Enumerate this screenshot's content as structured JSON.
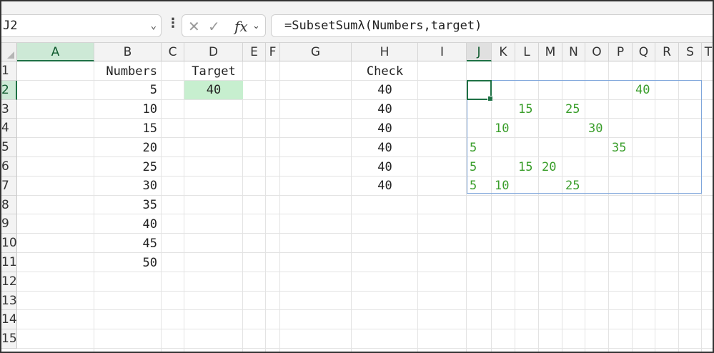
{
  "formula_bar": {
    "name_box": "J2",
    "formula": "=SubsetSumλ(Numbers,target)"
  },
  "icons": {
    "cancel": "close-icon",
    "confirm": "check-icon",
    "function": "fx-icon",
    "dropdown": "chevron-down-icon",
    "more": "kebab-icon"
  },
  "columns": [
    "A",
    "B",
    "C",
    "D",
    "E",
    "F",
    "G",
    "H",
    "I",
    "J",
    "K",
    "L",
    "M",
    "N",
    "O",
    "P",
    "Q",
    "R",
    "S",
    "T"
  ],
  "rows": [
    "1",
    "2",
    "3",
    "4",
    "5",
    "6",
    "7",
    "8",
    "9",
    "10",
    "11",
    "12",
    "13",
    "14",
    "15"
  ],
  "cells": {
    "B1": "Numbers",
    "B": [
      "5",
      "10",
      "15",
      "20",
      "25",
      "30",
      "35",
      "40",
      "45",
      "50"
    ],
    "D1": "Target",
    "D2": "40",
    "H1": "Check",
    "H": [
      "40",
      "40",
      "40",
      "40",
      "40",
      "40"
    ],
    "spill": [
      {
        "col": "Q",
        "row": 2,
        "value": "40"
      },
      {
        "col": "L",
        "row": 3,
        "value": "15"
      },
      {
        "col": "N",
        "row": 3,
        "value": "25"
      },
      {
        "col": "K",
        "row": 4,
        "value": "10"
      },
      {
        "col": "O",
        "row": 4,
        "value": "30"
      },
      {
        "col": "J",
        "row": 5,
        "value": "5"
      },
      {
        "col": "P",
        "row": 5,
        "value": "35"
      },
      {
        "col": "J",
        "row": 6,
        "value": "5"
      },
      {
        "col": "L",
        "row": 6,
        "value": "15"
      },
      {
        "col": "M",
        "row": 6,
        "value": "20"
      },
      {
        "col": "J",
        "row": 7,
        "value": "5"
      },
      {
        "col": "K",
        "row": 7,
        "value": "10"
      },
      {
        "col": "N",
        "row": 7,
        "value": "25"
      }
    ]
  },
  "colors": {
    "accent_green": "#1e7145",
    "value_green": "#3a9e2b",
    "target_fill": "#c7efcf",
    "spill_border": "#7fa6db"
  }
}
